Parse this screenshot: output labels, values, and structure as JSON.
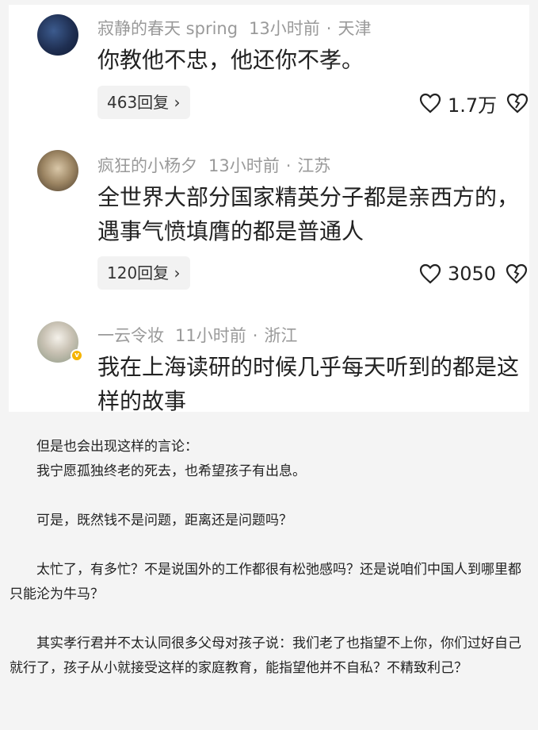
{
  "comments": [
    {
      "username": "寂静的春天 spring",
      "time": "13小时前",
      "location": "天津",
      "text": "你教他不忠，他还你不孝。",
      "reply_label": "463回复 ›",
      "likes": "1.7万"
    },
    {
      "username": "疯狂的小杨夕",
      "time": "13小时前",
      "location": "江苏",
      "text": "全世界大部分国家精英分子都是亲西方的，遇事气愤填膺的都是普通人",
      "reply_label": "120回复 ›",
      "likes": "3050"
    },
    {
      "username": "一云令妆",
      "time": "11小时前",
      "location": "浙江",
      "text": "我在上海读研的时候几乎每天听到的都是这样的故事"
    }
  ],
  "article": {
    "p1": "但是也会出现这样的言论：",
    "p2": "我宁愿孤独终老的死去，也希望孩子有出息。",
    "p3": "可是，既然钱不是问题，距离还是问题吗？",
    "p4": "太忙了，有多忙？不是说国外的工作都很有松弛感吗？还是说咱们中国人到哪里都只能沦为牛马？",
    "p5": "其实孝行君并不太认同很多父母对孩子说：我们老了也指望不上你，你们过好自己就行了，孩子从小就接受这样的家庭教育，能指望他并不自私？不精致利己？"
  },
  "icons": [
    "heart-icon",
    "broken-heart-icon",
    "verified-badge-icon"
  ],
  "colors": {
    "meta": "#9a9a9a",
    "text": "#222222",
    "background": "#f4f4f4",
    "verified": "#f5b400"
  }
}
